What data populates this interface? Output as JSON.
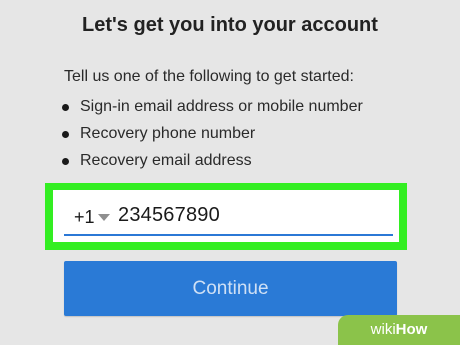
{
  "header": {
    "title": "Let's get you into your account"
  },
  "instructions": {
    "intro": "Tell us one of the following to get started:",
    "items": [
      "Sign-in email address or mobile number",
      "Recovery phone number",
      "Recovery email address"
    ]
  },
  "phone_input": {
    "country_code": "+1",
    "value": "234567890"
  },
  "continue_button": {
    "label": "Continue"
  },
  "watermark": {
    "part1": "wiki",
    "part2": "How"
  },
  "colors": {
    "background": "#e6e6e6",
    "highlight": "#33ee22",
    "accent": "#2a7ad6",
    "watermark": "#8bc34a"
  },
  "icons": {
    "country_dropdown": "chevron-down-icon",
    "bullet": "bullet-icon"
  }
}
